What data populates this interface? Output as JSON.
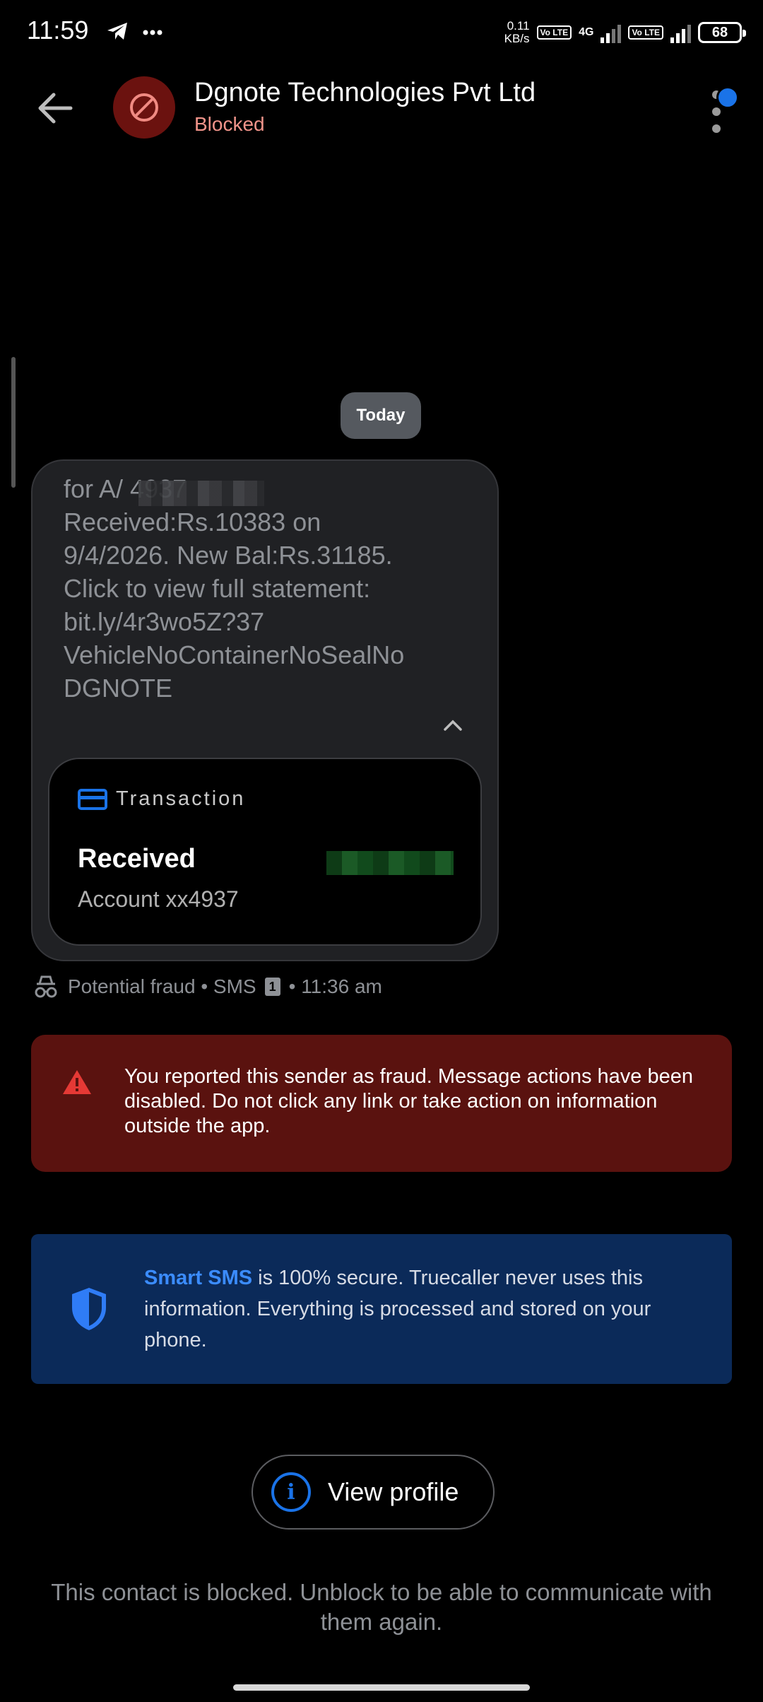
{
  "status_bar": {
    "time": "11:59",
    "net_speed_value": "0.11",
    "net_speed_unit": "KB/s",
    "volte1": "Vo LTE",
    "network_type": "4G",
    "volte2": "Vo LTE",
    "battery": "68"
  },
  "header": {
    "title": "Dgnote Technologies Pvt Ltd",
    "subtitle": "Blocked"
  },
  "date_chip": "Today",
  "message": {
    "text": "for A/          4937\nReceived:Rs.10383 on\n9/4/2026. New Bal:Rs.31185.\nClick to view full statement:\nbit.ly/4r3wo5Z?37\nVehicleNoContainerNoSealNo\nDGNOTE",
    "card": {
      "label": "Transaction",
      "title": "Received",
      "account": "Account xx4937"
    },
    "meta": {
      "label": "Potential fraud • SMS",
      "sim": "1",
      "time": "• 11:36 am"
    }
  },
  "fraud_notice": "You reported this sender as fraud. Message actions have been disabled. Do not click any link or take action on information outside the app.",
  "smart_sms": {
    "brand": "Smart SMS",
    "text": " is 100% secure. Truecaller never uses this information. Everything is processed and stored on your phone."
  },
  "view_profile_label": "View profile",
  "blocked_note": "This contact is blocked. Unblock to be able to communicate with them again.",
  "colors": {
    "accent": "#1a73e8",
    "fraud_bg": "#5a120f",
    "smart_bg": "#0b2a59",
    "blocked_text": "#f1948a"
  },
  "icons": [
    "back-arrow-icon",
    "blocked-icon",
    "more-vert-icon",
    "card-icon",
    "chevron-up-icon",
    "incognito-icon",
    "sim-icon",
    "warning-icon",
    "shield-icon",
    "info-icon",
    "telegram-icon"
  ]
}
